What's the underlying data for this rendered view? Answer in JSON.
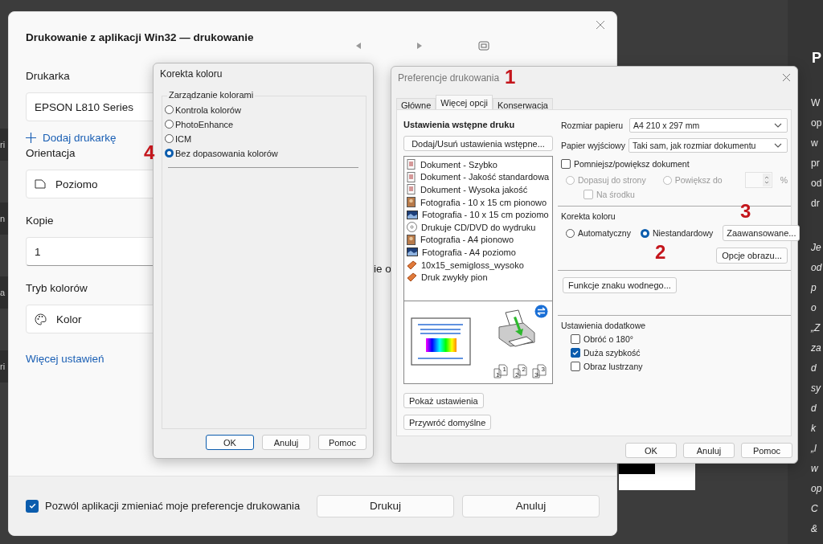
{
  "background_page": {
    "heading": "P",
    "lines": [
      {
        "text": "W",
        "italic": false
      },
      {
        "text": "op",
        "italic": false
      },
      {
        "text": "w",
        "italic": false
      },
      {
        "text": "pr",
        "italic": false
      },
      {
        "text": "od",
        "italic": false
      },
      {
        "text": "dr",
        "italic": false
      },
      {
        "text": "Je",
        "italic": true
      },
      {
        "text": "od",
        "italic": true
      },
      {
        "text": "p",
        "italic": true
      },
      {
        "text": "o",
        "italic": true
      },
      {
        "text": "„Z",
        "italic": true
      },
      {
        "text": "za",
        "italic": true
      },
      {
        "text": "d",
        "italic": true
      },
      {
        "text": "sy",
        "italic": true
      },
      {
        "text": "d",
        "italic": true
      },
      {
        "text": "k",
        "italic": true
      },
      {
        "text": "„l",
        "italic": true
      },
      {
        "text": "w",
        "italic": true
      },
      {
        "text": "op",
        "italic": true
      },
      {
        "text": "C",
        "italic": true
      },
      {
        "text": "&",
        "italic": true
      }
    ],
    "side_tabs": [
      "ri",
      "n",
      "a",
      "ri"
    ]
  },
  "print_dialog": {
    "title": "Drukowanie z aplikacji Win32 — drukowanie",
    "printer": {
      "label": "Drukarka",
      "value": "EPSON L810 Series"
    },
    "add_printer": "Dodaj drukarkę",
    "orientation": {
      "label": "Orientacja",
      "value": "Poziomo"
    },
    "copies": {
      "label": "Kopie",
      "value": "1"
    },
    "color_mode": {
      "label": "Tryb kolorów",
      "value": "Kolor"
    },
    "more_settings": "Więcej ustawień",
    "preview_text": "ie o",
    "allow_change": {
      "label": "Pozwól aplikacji zmieniać moje preferencje drukowania",
      "checked": true
    },
    "buttons": [
      "Drukuj",
      "Anuluj"
    ]
  },
  "color_dialog": {
    "title": "Korekta koloru",
    "group": "Zarządzanie kolorami",
    "options": [
      {
        "label": "Kontrola kolorów",
        "selected": false
      },
      {
        "label": "PhotoEnhance",
        "selected": false
      },
      {
        "label": "ICM",
        "selected": false
      },
      {
        "label": "Bez dopasowania kolorów",
        "selected": true
      }
    ],
    "buttons": [
      {
        "label": "OK",
        "default": true
      },
      {
        "label": "Anuluj",
        "default": false
      },
      {
        "label": "Pomoc",
        "default": false
      }
    ]
  },
  "prefs_dialog": {
    "title": "Preferencje drukowania",
    "tabs": [
      {
        "label": "Główne",
        "selected": false
      },
      {
        "label": "Więcej opcji",
        "selected": true
      },
      {
        "label": "Konserwacja",
        "selected": false
      }
    ],
    "presets_heading": "Ustawienia wstępne druku",
    "presets_button": "Dodaj/Usuń ustawienia wstępne...",
    "presets": [
      {
        "label": "Dokument - Szybko",
        "kind": "document"
      },
      {
        "label": "Dokument - Jakość standardowa",
        "kind": "document"
      },
      {
        "label": "Dokument - Wysoka jakość",
        "kind": "document"
      },
      {
        "label": "Fotografia - 10 x 15 cm pionowo",
        "kind": "portrait"
      },
      {
        "label": "Fotografia - 10 x 15 cm poziomo",
        "kind": "landscape"
      },
      {
        "label": "Drukuje CD/DVD do wydruku",
        "kind": "disc"
      },
      {
        "label": "Fotografia - A4 pionowo",
        "kind": "portrait"
      },
      {
        "label": "Fotografia - A4 poziomo",
        "kind": "landscape"
      },
      {
        "label": "10x15_semigloss_wysoko",
        "kind": "paper"
      },
      {
        "label": "Druk zwykły pion",
        "kind": "paper"
      }
    ],
    "copy_marks": [
      "1",
      "1",
      "2",
      "2",
      "3",
      "3"
    ],
    "show_settings": "Pokaż ustawienia",
    "restore_defaults": "Przywróć domyślne",
    "paper_size": {
      "label": "Rozmiar papieru",
      "value": "A4 210 x 297 mm"
    },
    "output_paper": {
      "label": "Papier wyjściowy",
      "value": "Taki sam, jak rozmiar dokumentu"
    },
    "reduce_enlarge": {
      "label": "Pomniejsz/powiększ dokument",
      "checked": false
    },
    "fit_to_page": {
      "label": "Dopasuj do strony",
      "selected": false,
      "disabled": true
    },
    "enlarge_to": {
      "label": "Powiększ do",
      "selected": false,
      "disabled": true
    },
    "percent": "%",
    "center": {
      "label": "Na środku",
      "checked": false,
      "disabled": true
    },
    "color_correction": {
      "label": "Korekta koloru",
      "options": [
        {
          "label": "Automatyczny",
          "selected": false
        },
        {
          "label": "Niestandardowy",
          "selected": true
        }
      ],
      "advanced": "Zaawansowane...",
      "image_options": "Opcje obrazu..."
    },
    "watermark": "Funkcje znaku wodnego...",
    "extra": {
      "label": "Ustawienia dodatkowe",
      "options": [
        {
          "label": "Obróć o 180°",
          "checked": false
        },
        {
          "label": "Duża szybkość",
          "checked": true
        },
        {
          "label": "Obraz lustrzany",
          "checked": false
        }
      ]
    },
    "buttons": [
      "OK",
      "Anuluj",
      "Pomoc"
    ]
  },
  "annotations": [
    "1",
    "2",
    "3",
    "4"
  ]
}
